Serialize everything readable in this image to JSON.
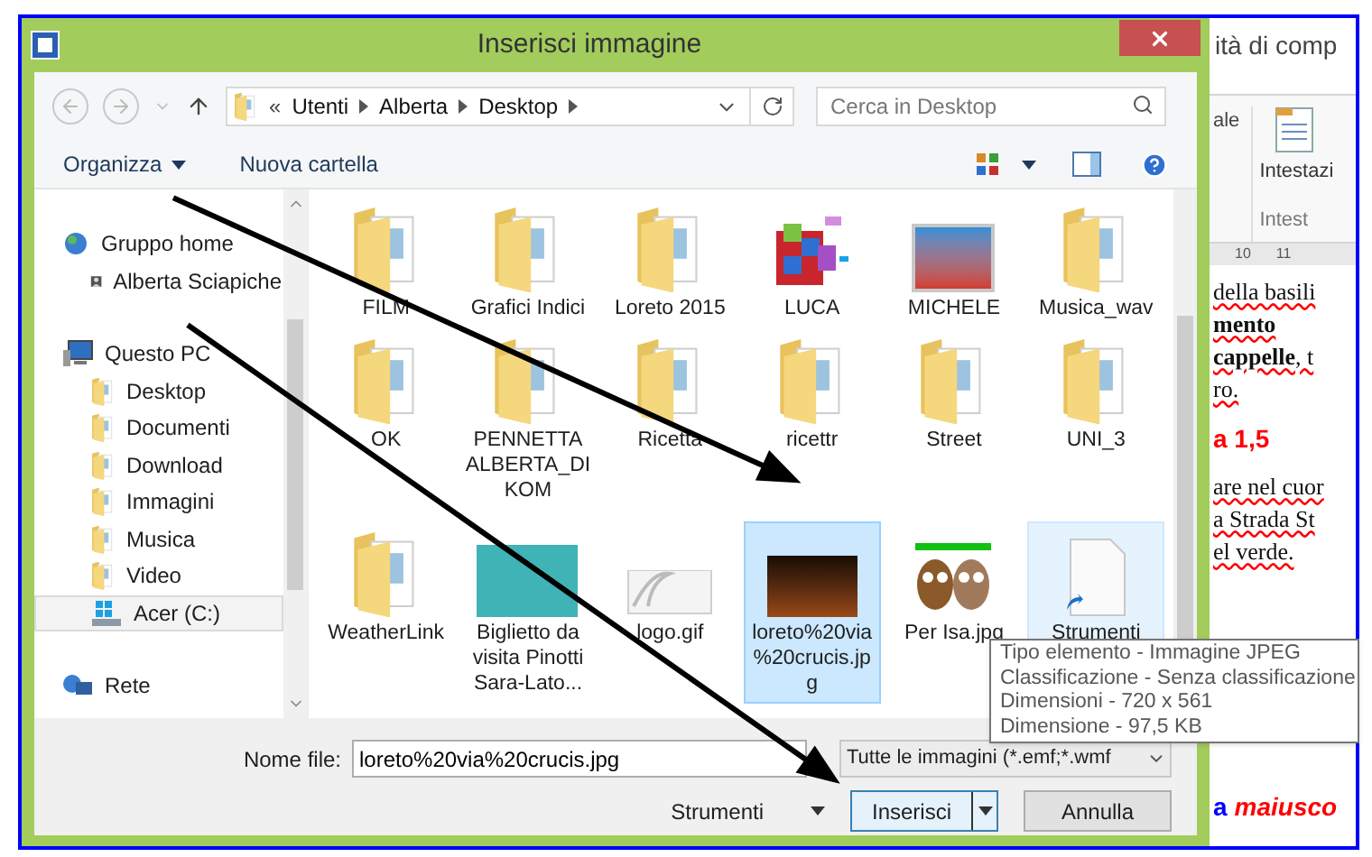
{
  "window": {
    "title": "Inserisci immagine"
  },
  "address": {
    "overflow": "«",
    "path": [
      "Utenti",
      "Alberta",
      "Desktop"
    ]
  },
  "search": {
    "placeholder": "Cerca in Desktop"
  },
  "toolbar": {
    "organize": "Organizza",
    "new_folder": "Nuova cartella"
  },
  "nav": [
    {
      "label": "Gruppo home",
      "kind": "homegroup",
      "selected": false,
      "children": [
        {
          "label": "Alberta Sciapiche",
          "kind": "user",
          "selected": false
        }
      ]
    },
    {
      "label": "Questo PC",
      "kind": "pc",
      "selected": false,
      "children": [
        {
          "label": "Desktop",
          "kind": "folder",
          "selected": false
        },
        {
          "label": "Documenti",
          "kind": "folder",
          "selected": false
        },
        {
          "label": "Download",
          "kind": "folder",
          "selected": false
        },
        {
          "label": "Immagini",
          "kind": "folder",
          "selected": false
        },
        {
          "label": "Musica",
          "kind": "folder",
          "selected": false
        },
        {
          "label": "Video",
          "kind": "folder",
          "selected": false
        },
        {
          "label": "Acer (C:)",
          "kind": "drive",
          "selected": true
        }
      ]
    },
    {
      "label": "Rete",
      "kind": "network",
      "selected": false
    }
  ],
  "files": [
    {
      "label": "FILM",
      "kind": "folder",
      "selected": false,
      "hovered": false
    },
    {
      "label": "Grafici Indici",
      "kind": "folder",
      "selected": false,
      "hovered": false
    },
    {
      "label": "Loreto 2015",
      "kind": "folder",
      "selected": false,
      "hovered": false
    },
    {
      "label": "LUCA",
      "kind": "app",
      "selected": false,
      "hovered": false
    },
    {
      "label": "MICHELE",
      "kind": "picture",
      "selected": false,
      "hovered": false
    },
    {
      "label": "Musica_wav",
      "kind": "folder",
      "selected": false,
      "hovered": false
    },
    {
      "label": "OK",
      "kind": "folder",
      "selected": false,
      "hovered": false
    },
    {
      "label": "PENNETTA ALBERTA_DIKOM",
      "kind": "folder",
      "selected": false,
      "hovered": false
    },
    {
      "label": "Ricetta",
      "kind": "folder",
      "selected": false,
      "hovered": false
    },
    {
      "label": "ricettr",
      "kind": "folder",
      "selected": false,
      "hovered": false
    },
    {
      "label": "Street",
      "kind": "folder",
      "selected": false,
      "hovered": false
    },
    {
      "label": "UNI_3",
      "kind": "folder",
      "selected": false,
      "hovered": false
    },
    {
      "label": "WeatherLink",
      "kind": "folder",
      "selected": false,
      "hovered": false
    },
    {
      "label": "Biglietto da visita Pinotti Sara-Lato...",
      "kind": "card",
      "selected": false,
      "hovered": false
    },
    {
      "label": "logo.gif",
      "kind": "logo",
      "selected": false,
      "hovered": false
    },
    {
      "label": "loreto%20via%20crucis.jpg",
      "kind": "photo",
      "selected": true,
      "hovered": false
    },
    {
      "label": "Per Isa.jpg",
      "kind": "cartoon",
      "selected": false,
      "hovered": false
    },
    {
      "label": "Strumenti",
      "kind": "shortcut",
      "selected": false,
      "hovered": true
    }
  ],
  "file_name": {
    "label": "Nome file:",
    "value": "loreto%20via%20crucis.jpg"
  },
  "file_type": {
    "value": "Tutte le immagini (*.emf;*.wmf"
  },
  "buttons": {
    "tools": "Strumenti",
    "insert": "Inserisci",
    "cancel": "Annulla"
  },
  "tooltip": [
    "Tipo elemento - Immagine JPEG",
    "Classificazione - Senza classificazione",
    "Dimensioni - 720 x 561",
    "Dimensione - 97,5 KB"
  ],
  "word": {
    "title": "ità di comp",
    "ribbon_group": "ale",
    "ribbon_button": "Intestazi",
    "ribbon_label": "Intest",
    "ruler": [
      "10",
      "11"
    ],
    "lines": [
      {
        "text": "della basili",
        "kind": "plain"
      },
      {
        "text": "mento",
        "kind": "bold"
      },
      {
        "text": "**cappelle**, t",
        "kind": "plain"
      },
      {
        "text": "ro.",
        "kind": "plain"
      },
      {
        "text": "a 1,5",
        "kind": "heading"
      },
      {
        "text": "are nel cuor",
        "kind": "plain"
      },
      {
        "text": "a Strada St",
        "kind": "plain"
      },
      {
        "text": "el verde.",
        "kind": "plain"
      }
    ],
    "caption": [
      "a",
      "maiusco"
    ]
  }
}
